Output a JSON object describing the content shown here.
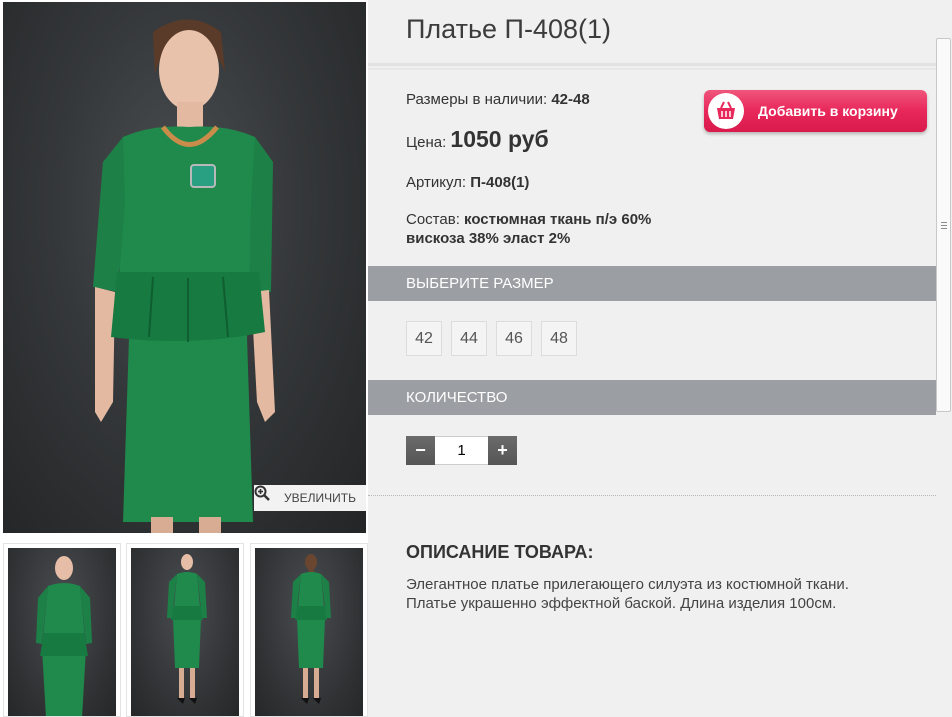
{
  "product": {
    "title": "Платье П-408(1)",
    "sizes_label": "Размеры в наличии:",
    "sizes_value": "42-48",
    "price_label": "Цена:",
    "price_value": "1050 руб",
    "article_label": "Артикул:",
    "article_value": "П-408(1)",
    "composition_label": "Состав:",
    "composition_value_line1": "костюмная ткань п/э 60%",
    "composition_value_line2": "вискоза 38% эласт 2%"
  },
  "cart_button": {
    "label": "Добавить в корзину",
    "icon": "basket-icon",
    "color": "#e8275a"
  },
  "size_section": {
    "header": "ВЫБЕРИТЕ РАЗМЕР",
    "options": [
      "42",
      "44",
      "46",
      "48"
    ]
  },
  "quantity_section": {
    "header": "КОЛИЧЕСТВО",
    "value": "1",
    "minus": "−",
    "plus": "+"
  },
  "gallery": {
    "zoom_label": "УВЕЛИЧИТЬ",
    "zoom_icon": "magnifier-plus-icon",
    "dress_color": "#1f8a4c"
  },
  "description": {
    "title": "ОПИСАНИЕ ТОВАРА:",
    "line1": "Элегантное  платье прилегающего силуэта из костюмной ткани.",
    "line2": "Платье украшенно эффектной баской. Длина изделия 100см."
  },
  "colors": {
    "section_bar": "#9b9ea2",
    "panel_bg": "#f0f0f0"
  }
}
